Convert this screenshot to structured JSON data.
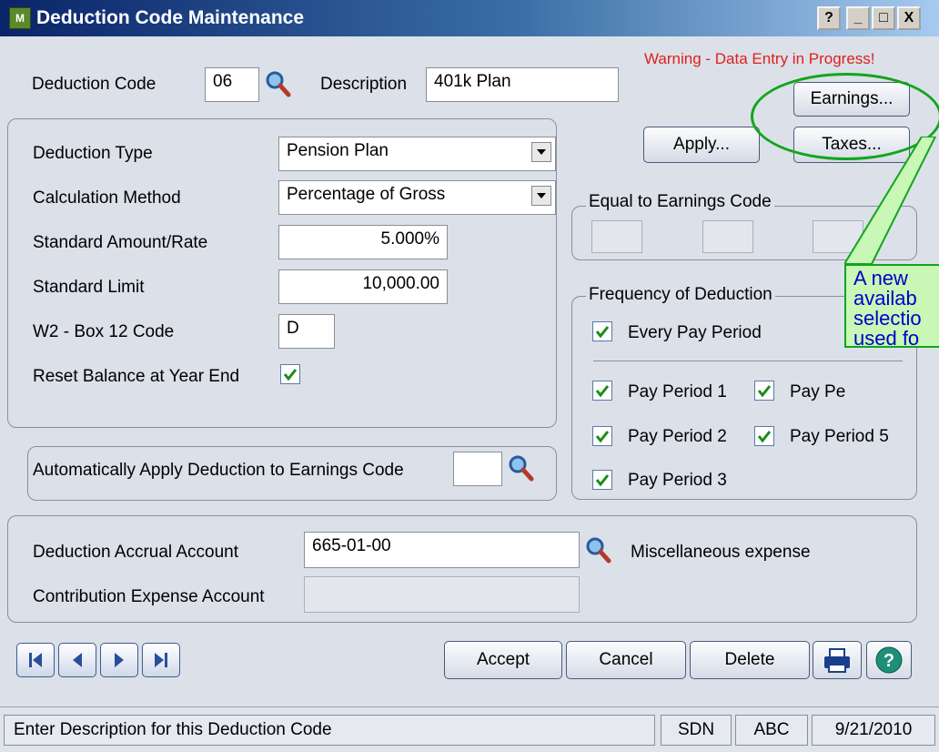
{
  "window": {
    "title": "Deduction Code Maintenance",
    "buttons": [
      "?",
      "_",
      "□",
      "X"
    ]
  },
  "header": {
    "deduction_code_label": "Deduction Code",
    "deduction_code_value": "06",
    "description_label": "Description",
    "description_value": "401k Plan",
    "warning": "Warning - Data Entry in Progress!"
  },
  "buttons": {
    "earnings": "Earnings...",
    "apply": "Apply...",
    "taxes": "Taxes..."
  },
  "main_group": {
    "deduction_type_label": "Deduction Type",
    "deduction_type_value": "Pension Plan",
    "calculation_method_label": "Calculation Method",
    "calculation_method_value": "Percentage of Gross",
    "standard_amount_label": "Standard Amount/Rate",
    "standard_amount_value": "5.000%",
    "standard_limit_label": "Standard Limit",
    "standard_limit_value": "10,000.00",
    "w2_label": "W2 - Box 12 Code",
    "w2_value": "D",
    "reset_label": "Reset Balance at Year End"
  },
  "auto_apply": {
    "label": "Automatically Apply Deduction to Earnings Code",
    "value": ""
  },
  "equal_group": {
    "title": "Equal to Earnings Code"
  },
  "frequency": {
    "title": "Frequency of Deduction",
    "every_pay_period": "Every Pay Period",
    "pay_period_1": "Pay Period 1",
    "pay_period_2": "Pay Period 2",
    "pay_period_3": "Pay Period 3",
    "pay_period_4": "Pay Pe",
    "pay_period_5": "Pay Period 5"
  },
  "accounts": {
    "accrual_label": "Deduction Accrual Account",
    "accrual_value": "665-01-00",
    "accrual_desc": "Miscellaneous expense",
    "contribution_label": "Contribution Expense Account",
    "contribution_value": ""
  },
  "actions": {
    "accept": "Accept",
    "cancel": "Cancel",
    "delete": "Delete"
  },
  "status": {
    "message": "Enter Description for this Deduction Code",
    "user": "SDN",
    "company": "ABC",
    "date": "9/21/2010"
  },
  "callout": {
    "line1": "A new",
    "line2": "availab",
    "line3": "selectio",
    "line4": "used fo"
  },
  "colors": {
    "warning": "#e0201a",
    "annotation_border": "#12a51c",
    "annotation_fill": "#c8f7b6",
    "annotation_text": "#0000c8"
  }
}
